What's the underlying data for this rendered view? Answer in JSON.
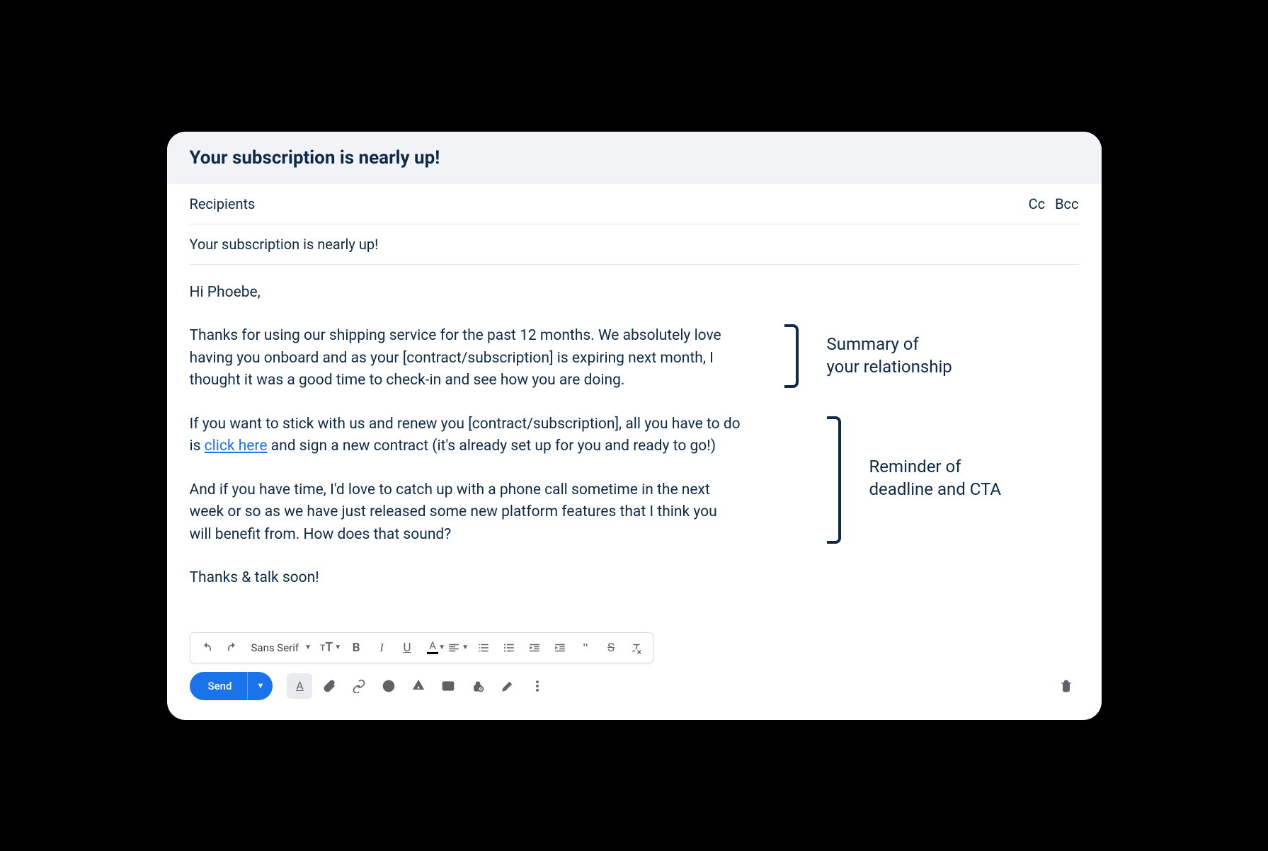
{
  "window": {
    "title": "Your subscription is nearly up!"
  },
  "fields": {
    "recipients_label": "Recipients",
    "cc": "Cc",
    "bcc": "Bcc",
    "subject": "Your subscription is nearly up!"
  },
  "body": {
    "greeting": "Hi Phoebe,",
    "p1": "Thanks for using our shipping service for the past 12 months. We absolutely love having you onboard and as your [contract/subscription] is expiring next month, I thought it was a good time to check-in and see how you are doing.",
    "p2a": "If you want to stick with us and renew you [contract/subscription], all you have to do is ",
    "p2_link": "click here",
    "p2b": " and sign a new contract (it's already set up for you and ready to go!)",
    "p3": "And if you have time, I'd love to catch up with a phone call sometime in the next week or so as we have just released some new platform features that I think you will benefit from. How does that sound?",
    "signoff": "Thanks & talk soon!"
  },
  "annotations": {
    "summary": "Summary of\nyour relationship",
    "reminder": "Reminder of\ndeadline and CTA"
  },
  "toolbar": {
    "font": "Sans Serif",
    "send": "Send"
  }
}
